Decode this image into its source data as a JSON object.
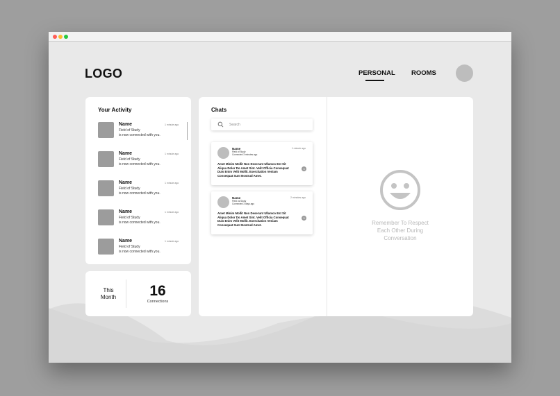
{
  "window": {
    "controls": [
      "close",
      "minimize",
      "maximize"
    ]
  },
  "header": {
    "logo": "LOGO",
    "nav": [
      {
        "label": "PERSONAL",
        "active": true
      },
      {
        "label": "ROOMS",
        "active": false
      }
    ]
  },
  "activity": {
    "title": "Your Activity",
    "items": [
      {
        "name": "Name",
        "field": "Field of Study",
        "message": "is now connected with you.",
        "time": "1 minute ago"
      },
      {
        "name": "Name",
        "field": "Field of Study",
        "message": "is now connected with you.",
        "time": "1 minute ago"
      },
      {
        "name": "Name",
        "field": "Field of Study",
        "message": "is now connected with you.",
        "time": "1 minute ago"
      },
      {
        "name": "Name",
        "field": "Field of Study",
        "message": "is now connected with you.",
        "time": "1 minute ago"
      },
      {
        "name": "Name",
        "field": "Field of Study",
        "message": "is now connected with you.",
        "time": "1 minute ago"
      }
    ]
  },
  "month": {
    "label": "This Month",
    "count": "16",
    "caption": "Connections"
  },
  "chats": {
    "title": "Chats",
    "search": {
      "placeholder": "Search"
    },
    "items": [
      {
        "name": "Name",
        "field": "Field of Study",
        "connected": "Connected 3 minutes ago",
        "time": "1 minute ago",
        "body": "Amet Minim Mollit Non Deserunt Ullamco Est Sit Aliqua Dolor Do Amet Sint. Velit Officia Consequat Duis Enim Velit Mollit. Exercitation Veniam Consequat Sunt Nostrud Amet.",
        "unread": "3"
      },
      {
        "name": "Name",
        "field": "Field os Study",
        "connected": "Connected 3 days ago",
        "time": "2 minutes ago",
        "body": "Amet Minim Mollit Non Deserunt Ullamco Est Sit Aliqua Dolor Do Amet Sint. Velit Officia Consequat Duis Enim Velit Mollit. Exercitation Veniam Consequat Sunt Nostrud Amet.",
        "unread": "3"
      }
    ]
  },
  "empty_state": {
    "icon": "smiley-icon",
    "message": "Remember To Respect Each Other During Conversation"
  },
  "colors": {
    "page_bg": "#9e9e9e",
    "window_bg": "#e9e9e9",
    "card_bg": "#ffffff",
    "placeholder_gray": "#9c9c9c",
    "smiley_gray": "#c4c4c4"
  }
}
